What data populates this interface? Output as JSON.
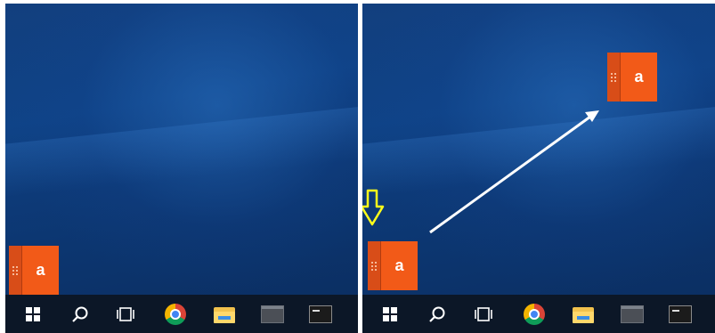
{
  "left_panel": {
    "app_widget_letter": "a",
    "taskbar": {
      "icons": [
        "windows-start-icon",
        "search-icon",
        "task-view-icon",
        "chrome-icon",
        "file-explorer-icon",
        "app-window-icon",
        "terminal-icon"
      ]
    }
  },
  "right_panel": {
    "app_widget_start_letter": "a",
    "app_widget_end_letter": "a",
    "annotations": {
      "down_arrow_color": "#ffff1a",
      "move_arrow_color": "#ffffff"
    },
    "taskbar": {
      "icons": [
        "windows-start-icon",
        "search-icon",
        "task-view-icon",
        "chrome-icon",
        "file-explorer-icon",
        "app-window-icon",
        "terminal-icon"
      ]
    }
  },
  "colors": {
    "widget_face": "#f25a18",
    "widget_grip": "#d84d18",
    "taskbar": "#0c1727"
  }
}
